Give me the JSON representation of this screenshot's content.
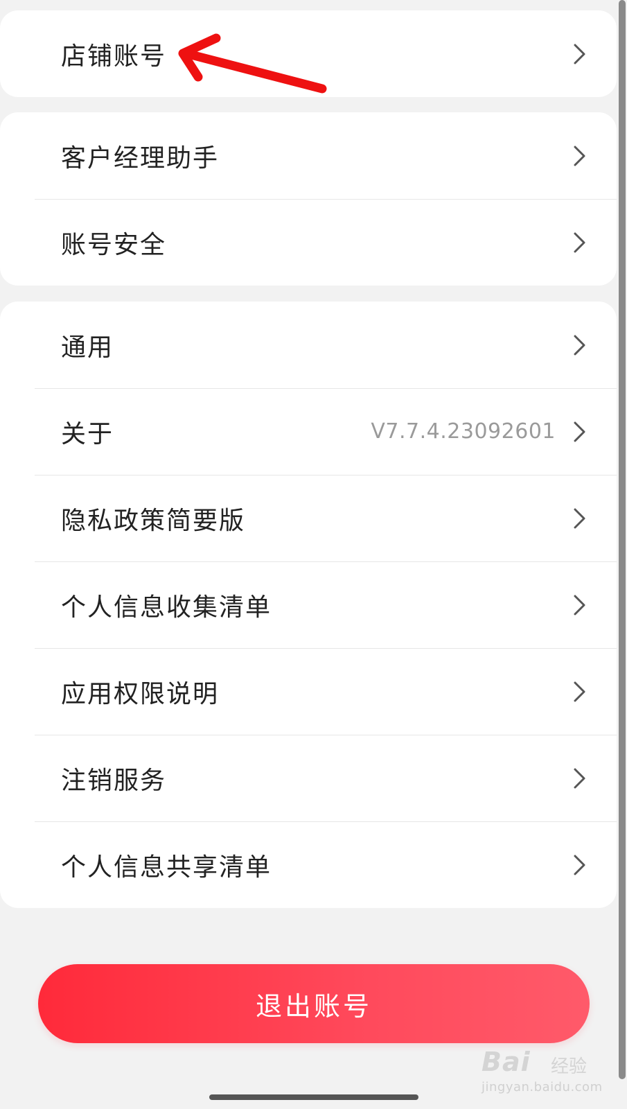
{
  "sections": [
    {
      "items": [
        {
          "label": "店铺账号"
        }
      ]
    },
    {
      "items": [
        {
          "label": "客户经理助手"
        },
        {
          "label": "账号安全"
        }
      ]
    },
    {
      "items": [
        {
          "label": "通用"
        },
        {
          "label": "关于",
          "value": "V7.7.4.23092601"
        },
        {
          "label": "隐私政策简要版"
        },
        {
          "label": "个人信息收集清单"
        },
        {
          "label": "应用权限说明"
        },
        {
          "label": "注销服务"
        },
        {
          "label": "个人信息共享清单"
        }
      ]
    }
  ],
  "logout_button": {
    "label": "退出账号"
  },
  "watermark": {
    "brand": "Bai",
    "brand_suffix": "经验",
    "url": "jingyan.baidu.com"
  },
  "colors": {
    "accent": "#ff2a3a",
    "annotation": "#ee1111",
    "background": "#f2f2f2"
  },
  "icons": {
    "row_chevron": "chevron-right-icon",
    "annotation": "red-arrow-annotation"
  }
}
